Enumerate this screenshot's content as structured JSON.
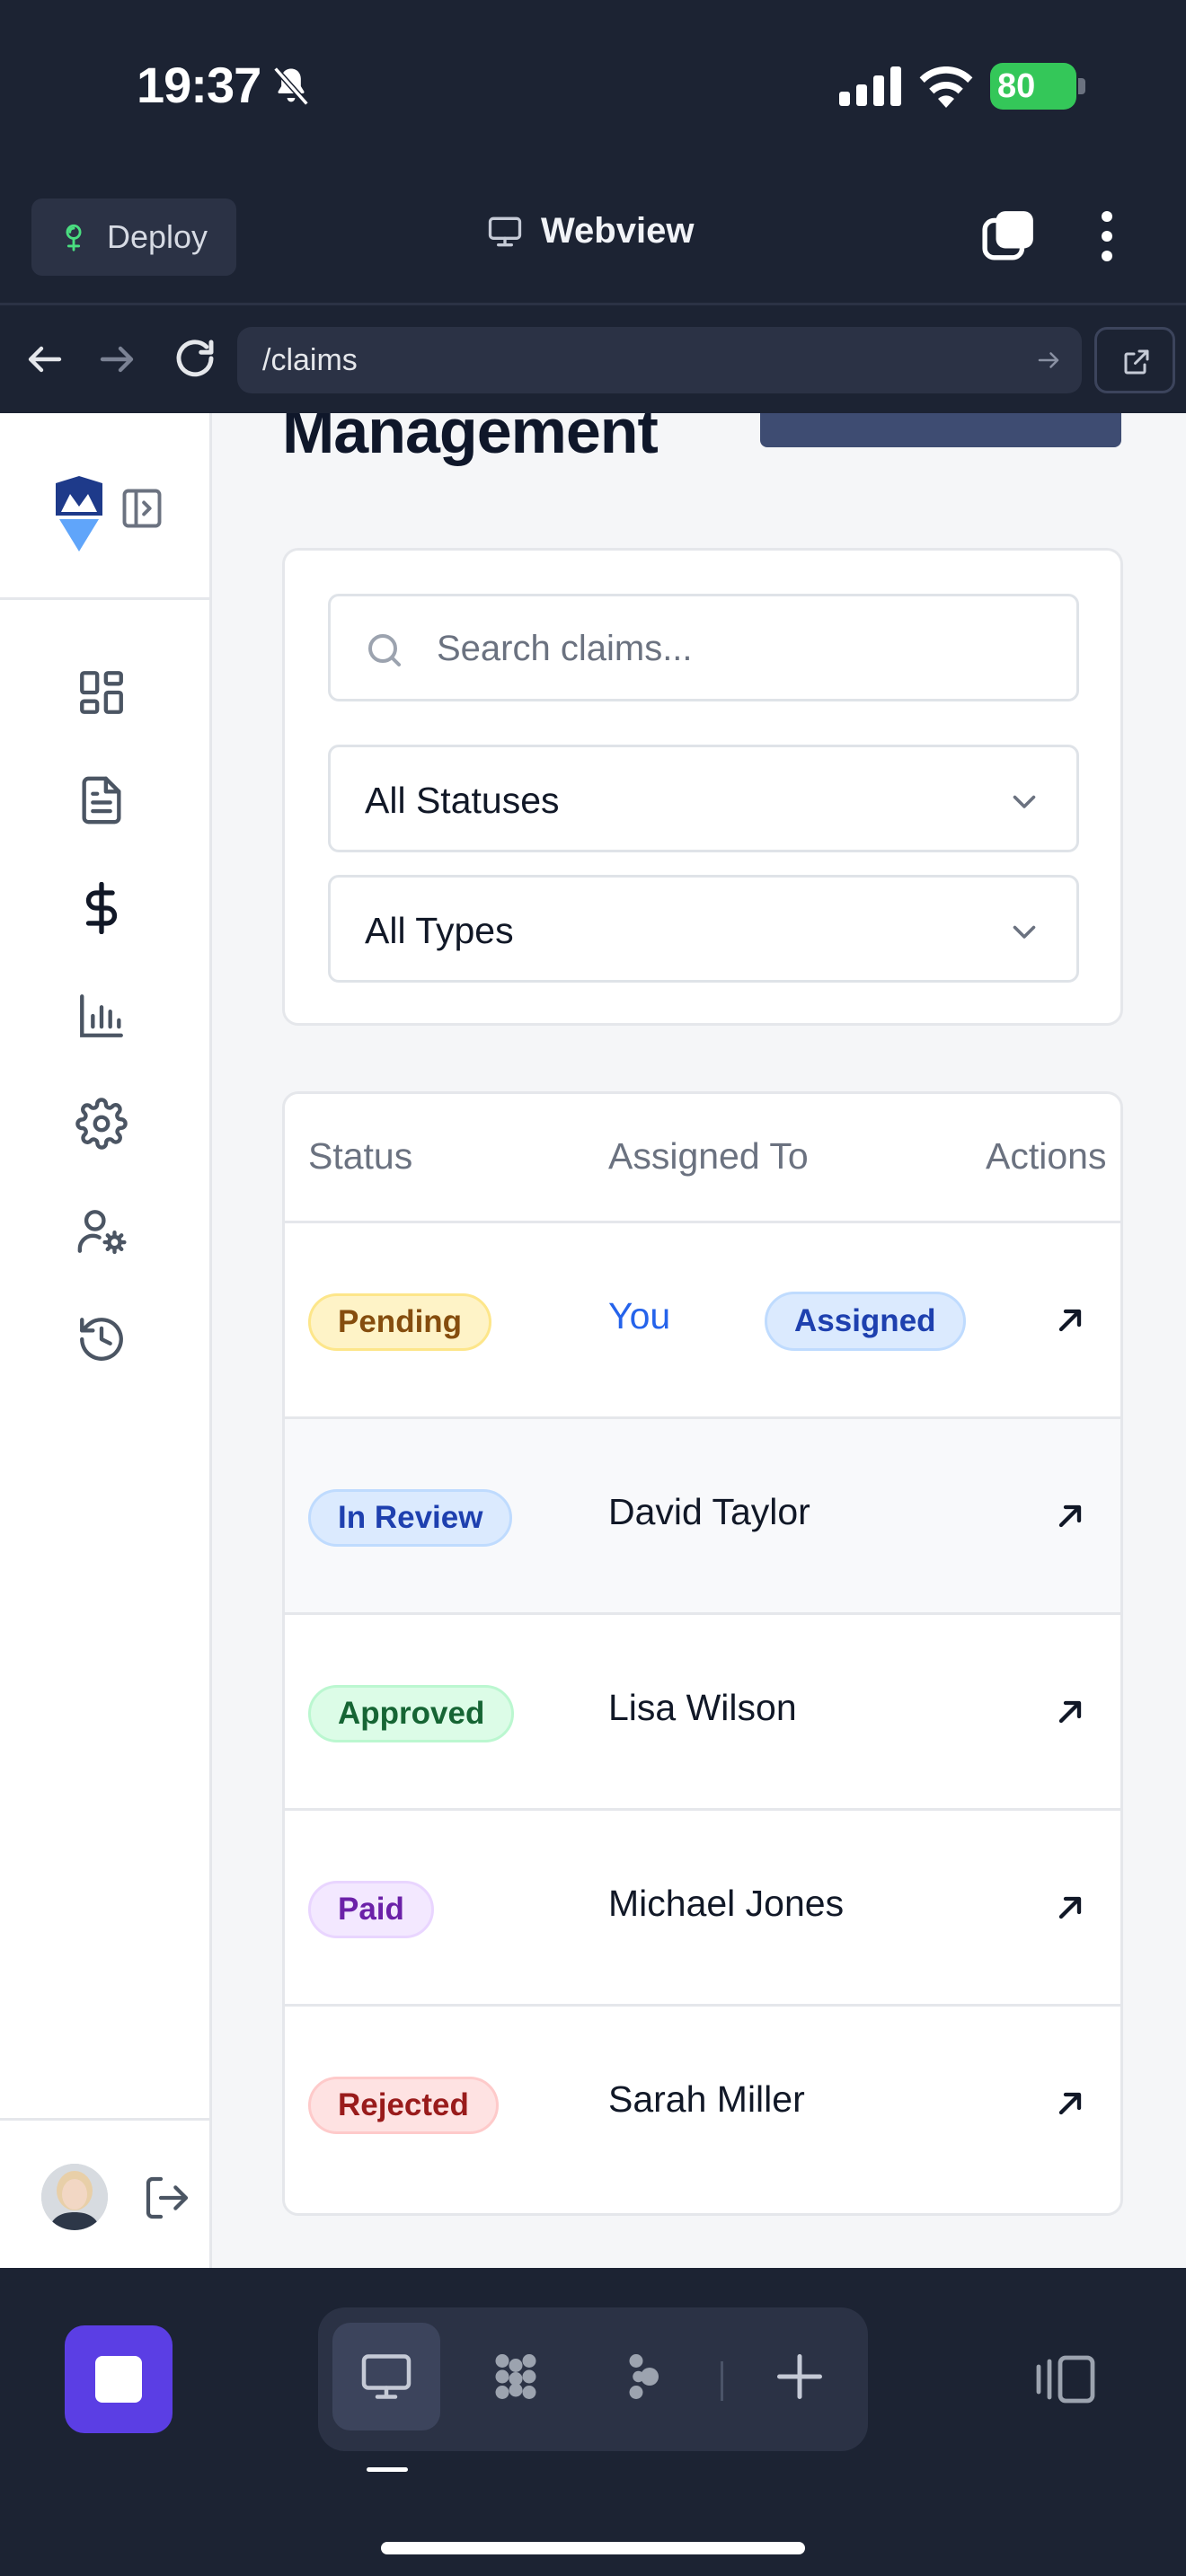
{
  "status_bar": {
    "time": "19:37",
    "battery": "80"
  },
  "top_bar": {
    "deploy_label": "Deploy",
    "webview_label": "Webview"
  },
  "url_bar": {
    "path": "/claims"
  },
  "page": {
    "title": "Management",
    "search_placeholder": "Search claims...",
    "status_filter": "All Statuses",
    "type_filter": "All Types"
  },
  "table": {
    "columns": [
      "Status",
      "Assigned To",
      "Actions"
    ],
    "rows": [
      {
        "status": "Pending",
        "assignee": "You",
        "tag": "Assigned"
      },
      {
        "status": "In Review",
        "assignee": "David Taylor"
      },
      {
        "status": "Approved",
        "assignee": "Lisa Wilson"
      },
      {
        "status": "Paid",
        "assignee": "Michael Jones"
      },
      {
        "status": "Rejected",
        "assignee": "Sarah Miller"
      }
    ]
  },
  "colors": {
    "accent": "#5b3ee4",
    "link": "#2563eb",
    "pending": "#fef3c7",
    "in_review": "#dbeafe",
    "approved": "#dcfce7",
    "paid": "#f3e8ff",
    "rejected": "#fee2e2"
  },
  "icons": {
    "sidebar": [
      "dashboard-icon",
      "document-icon",
      "dollar-icon",
      "chart-icon",
      "gear-icon",
      "user-settings-icon",
      "history-icon"
    ],
    "toolbar": [
      "monitor-icon",
      "apps-icon",
      "agent-icon",
      "plus-icon",
      "layout-icon"
    ]
  }
}
